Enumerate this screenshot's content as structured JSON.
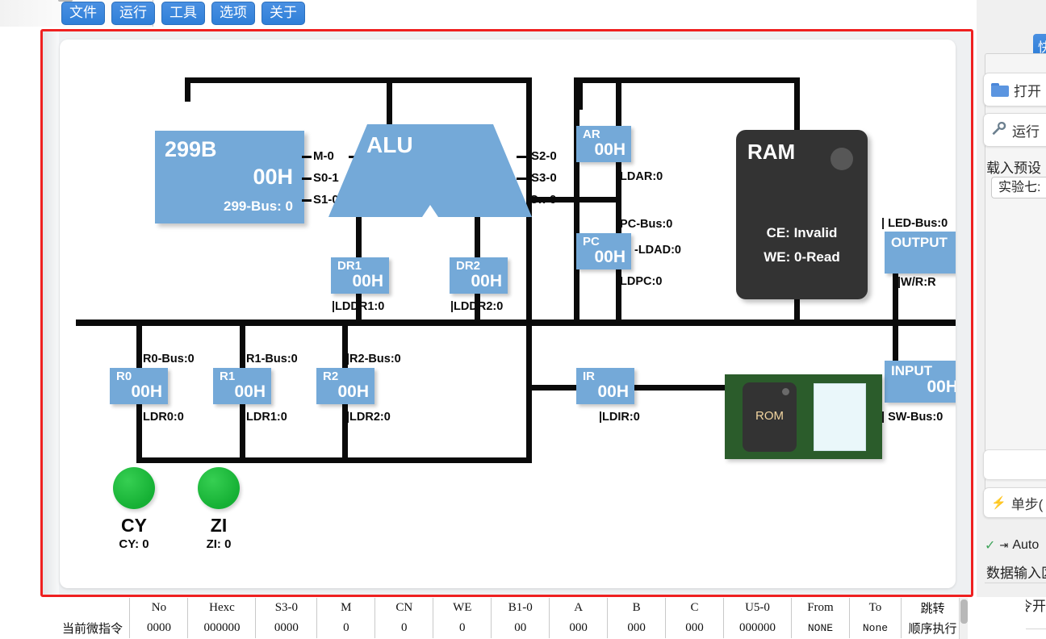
{
  "menu": {
    "items": [
      {
        "id": "file",
        "label": "文件"
      },
      {
        "id": "run",
        "label": "运行"
      },
      {
        "id": "tools",
        "label": "工具"
      },
      {
        "id": "options",
        "label": "选项"
      },
      {
        "id": "about",
        "label": "关于"
      }
    ]
  },
  "diagram": {
    "reg299": {
      "name": "299B",
      "value": "00H",
      "bus": "299-Bus: 0"
    },
    "alu": {
      "label": "ALU",
      "left_pins": [
        "M-0",
        "S0-1",
        "S1-0"
      ],
      "right_pins": [
        "S2-0",
        "S3-0",
        "Cn-0"
      ]
    },
    "dr1": {
      "name": "DR1",
      "value": "00H",
      "signal": "|LDDR1:0"
    },
    "dr2": {
      "name": "DR2",
      "value": "00H",
      "signal": "|LDDR2:0"
    },
    "ar": {
      "name": "AR",
      "value": "00H",
      "signal": "|LDAR:0"
    },
    "pc": {
      "name": "PC",
      "value": "00H",
      "bus": "|PC-Bus:0",
      "ldad": "-LDAD:0",
      "signal": "|LDPC:0"
    },
    "ram": {
      "label": "RAM",
      "ce": "CE: Invalid",
      "we": "WE: 0-Read"
    },
    "output": {
      "label": "OUTPUT",
      "bus": "| LED-Bus:0",
      "signal": "|W/R:R"
    },
    "input": {
      "name": "INPUT",
      "value": "00H",
      "bus": "| SW-Bus:0"
    },
    "r0": {
      "name": "R0",
      "value": "00H",
      "bus": "|R0-Bus:0",
      "signal": "|LDR0:0"
    },
    "r1": {
      "name": "R1",
      "value": "00H",
      "bus": "|R1-Bus:0",
      "signal": "|LDR1:0"
    },
    "r2": {
      "name": "R2",
      "value": "00H",
      "bus": "|R2-Bus:0",
      "signal": "|LDR2:0"
    },
    "ir": {
      "name": "IR",
      "value": "00H",
      "signal": "|LDIR:0"
    },
    "rom": {
      "label": "ROM"
    },
    "cy": {
      "title": "CY",
      "sub": "CY: 0"
    },
    "zi": {
      "title": "ZI",
      "sub": "ZI: 0"
    }
  },
  "sidebar": {
    "tab_label": "快",
    "open_button": "打开",
    "run_button": "运行",
    "preset_label": "载入预设",
    "preset_value": "实验七:",
    "step_button": "单步(",
    "auto_label": "Auto",
    "data_input_label": "数据输入区",
    "micro_label": "微指令开始"
  },
  "table": {
    "headers": [
      "",
      "No",
      "Hexc",
      "S3-0",
      "M",
      "CN",
      "WE",
      "B1-0",
      "A",
      "B",
      "C",
      "U5-0",
      "From",
      "To",
      "跳转"
    ],
    "row_label": "当前微指令",
    "row_values": [
      "0000",
      "000000",
      "0000",
      "0",
      "0",
      "0",
      "00",
      "000",
      "000",
      "000",
      "000000",
      "NONE",
      "None",
      "顺序执行"
    ]
  }
}
